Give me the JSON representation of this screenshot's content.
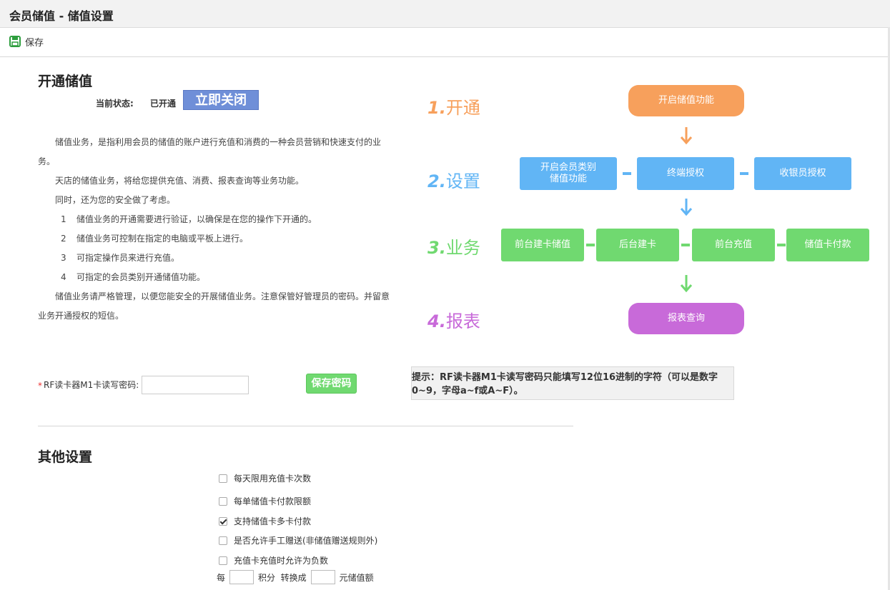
{
  "window": {
    "title": "会员储值 - 储值设置"
  },
  "toolbar": {
    "save_label": "保存"
  },
  "section1": {
    "title": "开通储值",
    "status_label": "当前状态:",
    "status_value": "已开通",
    "close_button": "立即关闭",
    "paragraphs": [
      "储值业务，是指利用会员的储值的账户进行充值和消费的一种会员营销和快速支付的业",
      "务。",
      "天店的储值业务，将给您提供充值、消费、报表查询等业务功能。",
      "同时，还为您的安全做了考虑。"
    ],
    "list": [
      {
        "n": "1",
        "text": "储值业务的开通需要进行验证，以确保是在您的操作下开通的。"
      },
      {
        "n": "2",
        "text": "储值业务可控制在指定的电脑或平板上进行。"
      },
      {
        "n": "3",
        "text": "可指定操作员来进行充值。"
      },
      {
        "n": "4",
        "text": "可指定的会员类别开通储值功能。"
      }
    ],
    "closing_1": "储值业务请严格管理，以便您能安全的开展储值业务。注意保管好管理员的密码。并留意",
    "closing_2": "业务开通授权的短信。"
  },
  "flow": {
    "steps": [
      {
        "num": "1.",
        "label": "开通",
        "color": "#f7a05c"
      },
      {
        "num": "2.",
        "label": "设置",
        "color": "#61b5f5"
      },
      {
        "num": "3.",
        "label": "业务",
        "color": "#70d970"
      },
      {
        "num": "4.",
        "label": "报表",
        "color": "#c86ad9"
      }
    ],
    "enable_box": "开启储值功能",
    "setup_boxes": [
      "开启会员类别\n储值功能",
      "终端授权",
      "收银员授权"
    ],
    "business_boxes": [
      "前台建卡储值",
      "后台建卡",
      "前台充值",
      "储值卡付款"
    ],
    "report_box": "报表查询"
  },
  "rf": {
    "required_mark": "*",
    "label": "RF读卡器M1卡读写密码:",
    "value": "",
    "save_button": "保存密码",
    "tip_line1": "提示：RF读卡器M1卡读写密码只能填写12位16进制的字符（可以是数字",
    "tip_line2": "0~9，字母a~f或A~F）。"
  },
  "section2": {
    "title": "其他设置",
    "checkboxes": [
      {
        "label": "每天限用充值卡次数",
        "checked": false
      },
      {
        "label": "每单储值卡付款限额",
        "checked": false
      },
      {
        "label": "支持储值卡多卡付款",
        "checked": true
      },
      {
        "label": "是否允许手工赠送(非储值赠送规则外)",
        "checked": false
      },
      {
        "label": "充值卡充值时允许为负数",
        "checked": false
      }
    ],
    "points_prefix": "每",
    "points_mid": "积分  转换成",
    "points_suffix": "元储值额"
  }
}
